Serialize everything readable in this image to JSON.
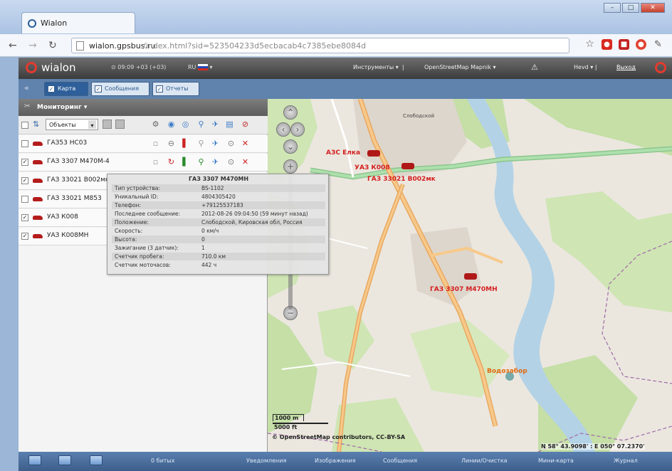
{
  "browser": {
    "tab_title": "Wialon",
    "url_host": "wialon.gpsbus.ru",
    "url_rest": "/index.html?sid=523504233d5ecbacab4c7385ebe8084d"
  },
  "header": {
    "logo": "wialon",
    "time": "09:09 +03 (+03)",
    "lang": "RU",
    "tools": "Инструменты",
    "map_source": "OpenStreetMap Mapnik",
    "user": "Hevd",
    "exit": "Выход"
  },
  "tabs": [
    {
      "label": "Карта",
      "active": true
    },
    {
      "label": "Сообщения",
      "active": false
    },
    {
      "label": "Отчеты",
      "active": false
    }
  ],
  "panel": {
    "title": "Мониторинг",
    "filter_label": "Объекты",
    "units": [
      {
        "name": "ГАЗ53 НС03",
        "checked": false
      },
      {
        "name": "ГАЗ 3307 М470М-4",
        "checked": true
      },
      {
        "name": "ГАЗ 33021 В002мк",
        "checked": true
      },
      {
        "name": "ГАЗ 33021 М853",
        "checked": false
      },
      {
        "name": "УАЗ К008",
        "checked": true
      },
      {
        "name": "УАЗ К008МН",
        "checked": true
      }
    ]
  },
  "tooltip": {
    "title": "ГАЗ 3307 М470МН",
    "rows": [
      {
        "k": "Тип устройства:",
        "v": "BS-1102"
      },
      {
        "k": "Уникальный ID:",
        "v": "4804305420"
      },
      {
        "k": "Телефон:",
        "v": "+79125537183"
      },
      {
        "k": "Последнее сообщение:",
        "v": "2012-08-26 09:04:50 (59 минут назад)"
      },
      {
        "k": "Положение:",
        "v": "Слободской, Кировская обл, Россия"
      },
      {
        "k": "Скорость:",
        "v": "0 км/ч"
      },
      {
        "k": "Высота:",
        "v": "0"
      },
      {
        "k": "Зажигание (3 датчик):",
        "v": "1"
      },
      {
        "k": "Счетчик пробега:",
        "v": "710.0 км"
      },
      {
        "k": "Счетчик моточасов:",
        "v": "442 ч"
      }
    ]
  },
  "map": {
    "labels": {
      "azs": "АЗС Елка",
      "uaz": "УАЗ К008",
      "gaz1": "ГАЗ 33021 В002мк",
      "gaz2": "ГАЗ 3307 М470МН",
      "vodo": "Водозабор",
      "town": "Слободской"
    },
    "scale_m": "1000 m",
    "scale_ft": "5000 ft",
    "copyright": "© OpenStreetMap contributors, CC-BY-SA",
    "coords": "N 58° 43.9098' : E 050° 07.2370'"
  },
  "bottom": {
    "tracks": "0 битых",
    "items": [
      "Уведомления",
      "Изображения",
      "Сообщения",
      "Линии/Очистка",
      "Мини-карта",
      "Журнал"
    ]
  },
  "colors": {
    "accent": "#e23b2e",
    "unit_label": "#d41e1e",
    "panel_header": "#5f83ad"
  }
}
